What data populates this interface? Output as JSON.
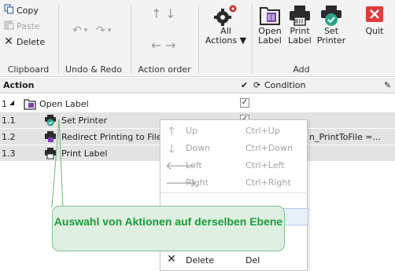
{
  "ribbon": {
    "clipboard": {
      "copy": "Copy",
      "paste": "Paste",
      "delete": "Delete",
      "group": "Clipboard"
    },
    "undo_redo": {
      "group": "Undo & Redo"
    },
    "action_order": {
      "group": "Action order"
    },
    "all_actions": {
      "line1": "All",
      "line2": "Actions"
    },
    "add": {
      "open_label": {
        "line1": "Open",
        "line2": "Label"
      },
      "print_label": {
        "line1": "Print",
        "line2": "Label"
      },
      "set_printer": {
        "line1": "Set",
        "line2": "Printer"
      },
      "group": "Add"
    },
    "quit": "Quit"
  },
  "grid": {
    "col_action": "Action",
    "col_condition": "Condition",
    "rows": [
      {
        "num": "1",
        "label": "Open Label",
        "checked": "✓"
      },
      {
        "num": "1.1",
        "label": "Set Printer",
        "checked": "✓"
      },
      {
        "num": "1.2",
        "label": "Redirect Printing to File",
        "condition": "n_PrintToFile =..."
      },
      {
        "num": "1.3",
        "label": "Print Label"
      }
    ]
  },
  "context_menu": {
    "items": [
      {
        "label": "Up",
        "shortcut": "Ctrl+Up",
        "icon": "arrow-up-icon"
      },
      {
        "label": "Down",
        "shortcut": "Ctrl+Down",
        "icon": "arrow-down-icon"
      },
      {
        "label": "Left",
        "shortcut": "Ctrl+Left",
        "icon": "arrow-left-icon"
      },
      {
        "label": "Right",
        "shortcut": "Ctrl+Right",
        "icon": "arrow-right-icon"
      },
      {
        "label": "Delete",
        "shortcut": "Del",
        "icon": "delete-icon"
      }
    ]
  },
  "callout": {
    "text": "Auswahl von Aktionen auf derselben Ebene"
  },
  "colors": {
    "callout_text": "#1a9b3a",
    "callout_bg": "#dff0e2",
    "quit_red": "#e03c3c",
    "set_printer_teal": "#2aa58c"
  }
}
